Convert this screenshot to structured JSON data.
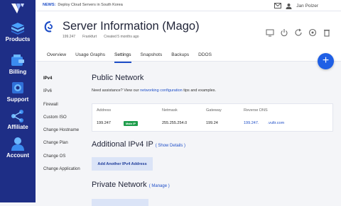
{
  "news": {
    "label": "NEWS:",
    "text": "Deploy Cloud Servers in South Korea"
  },
  "user": {
    "name": "Jan Polzer"
  },
  "sidebar": {
    "items": [
      {
        "label": "Products",
        "icon": "cube-stack-icon"
      },
      {
        "label": "Billing",
        "icon": "wallet-icon"
      },
      {
        "label": "Support",
        "icon": "life-ring-icon"
      },
      {
        "label": "Affiliate",
        "icon": "share-icon"
      },
      {
        "label": "Account",
        "icon": "user-icon"
      }
    ]
  },
  "server": {
    "title": "Server Information (Mago)",
    "ip": "199.247",
    "location": "Frankfurt",
    "created": "Created 5 months ago",
    "os_icon": "debian-icon"
  },
  "tabs": [
    "Overview",
    "Usage Graphs",
    "Settings",
    "Snapshots",
    "Backups",
    "DDOS"
  ],
  "active_tab": "Settings",
  "subnav": [
    "IPv4",
    "IPv6",
    "Firewall",
    "Custom ISO",
    "Change Hostname",
    "Change Plan",
    "Change OS",
    "Change Application"
  ],
  "public_network": {
    "title": "Public Network",
    "help_prefix": "Need assistance? View our ",
    "help_link": "networking configuration",
    "help_suffix": " tips and examples.",
    "columns": [
      "Address",
      "Netmask",
      "Gateway",
      "Reverse DNS"
    ],
    "row": {
      "address": "199.247",
      "badge": "Main IP",
      "netmask": "255.255.254.0",
      "gateway": "199.24",
      "rdns": "199.247.        .vultr.com"
    }
  },
  "additional_ipv4": {
    "title": "Additional IPv4 IP",
    "link": "( Show Details )",
    "button": "Add Another IPv4 Address"
  },
  "private_network": {
    "title": "Private Network",
    "link": "( Manage )"
  },
  "colors": {
    "sidebar": "#1e2e86",
    "accent": "#1e4ec7",
    "fab": "#1f5fe5",
    "badge": "#1e9d4b"
  }
}
